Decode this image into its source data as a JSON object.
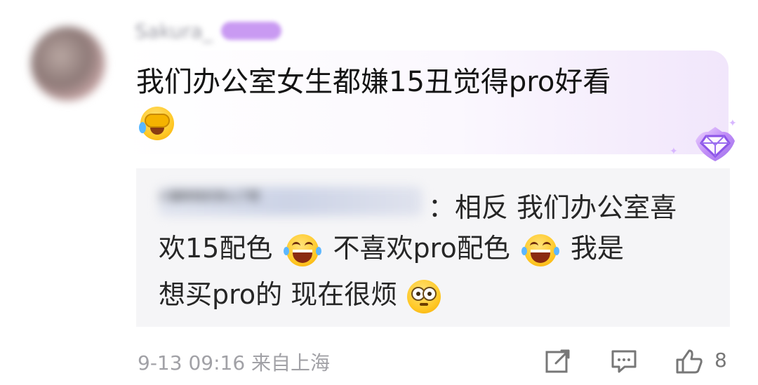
{
  "comment": {
    "username": "Sakura_",
    "text_line_1": "我们办公室女生都嫌15丑觉得pro好看",
    "emoji_1": "facepalm"
  },
  "reply": {
    "username": "小猫咪有好多心了呢",
    "line_1": "：相反 我们办公室喜",
    "line_2_part_1": "欢15配色",
    "line_2_part_2": "不喜欢pro配色",
    "line_2_part_3": "我是",
    "line_3_part_1": "想买pro的 现在很烦",
    "emoji_laugh_1": "laughing-with-tears",
    "emoji_laugh_2": "laughing-with-tears",
    "emoji_dizzy": "dizzy-face"
  },
  "footer": {
    "meta": "9-13 09:16 来自上海",
    "like_count": "8"
  },
  "icons": {
    "share": "share-icon",
    "comment": "comment-icon",
    "like": "like-icon",
    "badge": "diamond-badge-icon"
  },
  "colors": {
    "background": "#ffffff",
    "accent": "#b889f4",
    "reply_bg": "#f5f5f7",
    "meta_text": "#a1a1a6"
  }
}
